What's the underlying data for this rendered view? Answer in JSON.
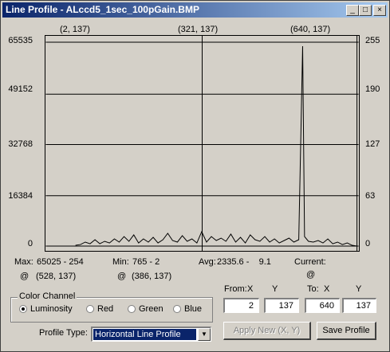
{
  "window": {
    "title": "Line Profile - ALccd5_1sec_100pGain.BMP",
    "controls": {
      "minimize": "_",
      "maximize": "□",
      "close": "×"
    }
  },
  "plot": {
    "top_labels": [
      "(2, 137)",
      "(321, 137)",
      "(640, 137)"
    ],
    "left_axis": [
      "65535",
      "49152",
      "32768",
      "16384",
      "0"
    ],
    "right_axis": [
      "255",
      "190",
      "127",
      "63",
      "0"
    ]
  },
  "chart_data": {
    "type": "line",
    "x_range": [
      2,
      640
    ],
    "y_range": [
      0,
      255
    ],
    "marker_x": [
      2,
      321,
      640
    ],
    "y_left_ticks": [
      0,
      16384,
      32768,
      49152,
      65535
    ],
    "y_right_ticks": [
      0,
      63,
      127,
      190,
      255
    ],
    "series": [
      {
        "values": [
          [
            60,
            1
          ],
          [
            70,
            2
          ],
          [
            80,
            5
          ],
          [
            90,
            3
          ],
          [
            100,
            8
          ],
          [
            110,
            3
          ],
          [
            120,
            6
          ],
          [
            130,
            4
          ],
          [
            140,
            9
          ],
          [
            150,
            5
          ],
          [
            160,
            12
          ],
          [
            170,
            6
          ],
          [
            180,
            14
          ],
          [
            190,
            4
          ],
          [
            200,
            9
          ],
          [
            210,
            5
          ],
          [
            220,
            11
          ],
          [
            230,
            4
          ],
          [
            240,
            8
          ],
          [
            250,
            16
          ],
          [
            260,
            7
          ],
          [
            270,
            5
          ],
          [
            280,
            13
          ],
          [
            290,
            6
          ],
          [
            300,
            9
          ],
          [
            310,
            4
          ],
          [
            320,
            18
          ],
          [
            330,
            5
          ],
          [
            340,
            12
          ],
          [
            350,
            7
          ],
          [
            360,
            10
          ],
          [
            370,
            6
          ],
          [
            380,
            15
          ],
          [
            390,
            5
          ],
          [
            400,
            11
          ],
          [
            410,
            4
          ],
          [
            420,
            14
          ],
          [
            430,
            8
          ],
          [
            440,
            6
          ],
          [
            450,
            12
          ],
          [
            460,
            5
          ],
          [
            470,
            9
          ],
          [
            480,
            4
          ],
          [
            490,
            7
          ],
          [
            500,
            10
          ],
          [
            510,
            5
          ],
          [
            520,
            8
          ],
          [
            528,
            250
          ],
          [
            532,
            12
          ],
          [
            540,
            6
          ],
          [
            550,
            5
          ],
          [
            560,
            7
          ],
          [
            570,
            4
          ],
          [
            580,
            9
          ],
          [
            590,
            3
          ],
          [
            600,
            5
          ],
          [
            610,
            2
          ],
          [
            620,
            4
          ],
          [
            630,
            1
          ],
          [
            640,
            0
          ]
        ]
      }
    ]
  },
  "stats": {
    "max_label": "Max:",
    "max_value": "65025 - 254",
    "max_at": "@",
    "max_pos": "(528, 137)",
    "min_label": "Min:",
    "min_value": "765 - 2",
    "min_at": "@",
    "min_pos": "(386, 137)",
    "avg_label": "Avg:",
    "avg_value": "2335.6 -    9.1",
    "current_label": "Current:",
    "current_at": "@"
  },
  "color_channel": {
    "title": "Color Channel",
    "options": [
      {
        "label": "Luminosity",
        "selected": true
      },
      {
        "label": "Red",
        "selected": false
      },
      {
        "label": "Green",
        "selected": false
      },
      {
        "label": "Blue",
        "selected": false
      }
    ]
  },
  "coords": {
    "from_label": "From:",
    "x_label": "X",
    "y_label": "Y",
    "to_label": "To:",
    "to_x_label": "X",
    "to_y_label": "Y",
    "from_x": "2",
    "from_y": "137",
    "to_x": "640",
    "to_y": "137"
  },
  "profile_type": {
    "label": "Profile Type:",
    "value": "Horizontal Line Profile"
  },
  "buttons": {
    "apply": "Apply New (X, Y)",
    "save": "Save Profile"
  }
}
